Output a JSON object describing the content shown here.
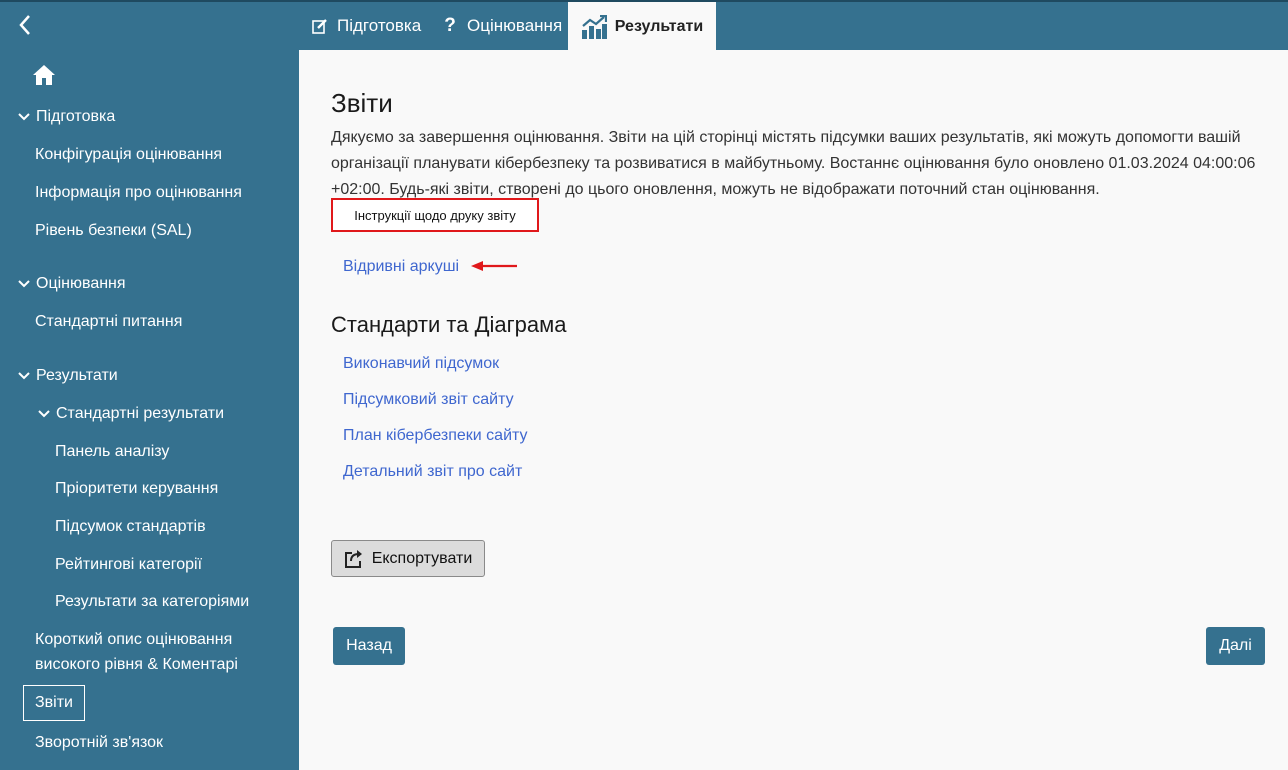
{
  "tabs": {
    "preparation": "Підготовка",
    "assessment": "Оцінювання",
    "results": "Результати"
  },
  "sidebar": {
    "preparation_header": "Підготовка",
    "config": "Конфігурація оцінювання",
    "info": "Інформація про оцінювання",
    "sal": "Рівень безпеки (SAL)",
    "assessment_header": "Оцінювання",
    "standard_questions": "Стандартні питання",
    "results_header": "Результати",
    "standard_results": "Стандартні результати",
    "analysis_dashboard": "Панель аналізу",
    "control_priorities": "Пріоритети керування",
    "standards_summary": "Підсумок стандартів",
    "ranked_categories": "Рейтингові категорії",
    "results_by_category": "Результати за категоріями",
    "high_level_summary": "Короткий опис оцінювання високого рівня & Коментарі",
    "reports": "Звіти",
    "feedback": "Зворотній зв'язок"
  },
  "main": {
    "title": "Звіти",
    "intro": "Дякуємо за завершення оцінювання. Звіти на цій сторінці містять підсумки ваших результатів, які можуть допомогти вашій організації планувати кібербезпеку та розвиватися в майбутньому. Востаннє оцінювання було оновлено 01.03.2024 04:00:06 +02:00. Будь-які звіти, створені до цього оновлення, можуть не відображати поточний стан оцінювання.",
    "print_instructions": "Інструкції щодо друку звіту",
    "tear_sheets": "Відривні аркуші",
    "section_title": "Стандарти та Діаграма",
    "executive_summary": "Виконавчий підсумок",
    "site_summary": "Підсумковий звіт сайту",
    "site_plan": "План кібербезпеки сайту",
    "site_detail": "Детальний звіт про сайт",
    "export": "Експортувати",
    "back": "Назад",
    "next": "Далі"
  },
  "colors": {
    "primary": "#35718f",
    "link": "#3f67cf",
    "highlight": "#e0181b"
  }
}
